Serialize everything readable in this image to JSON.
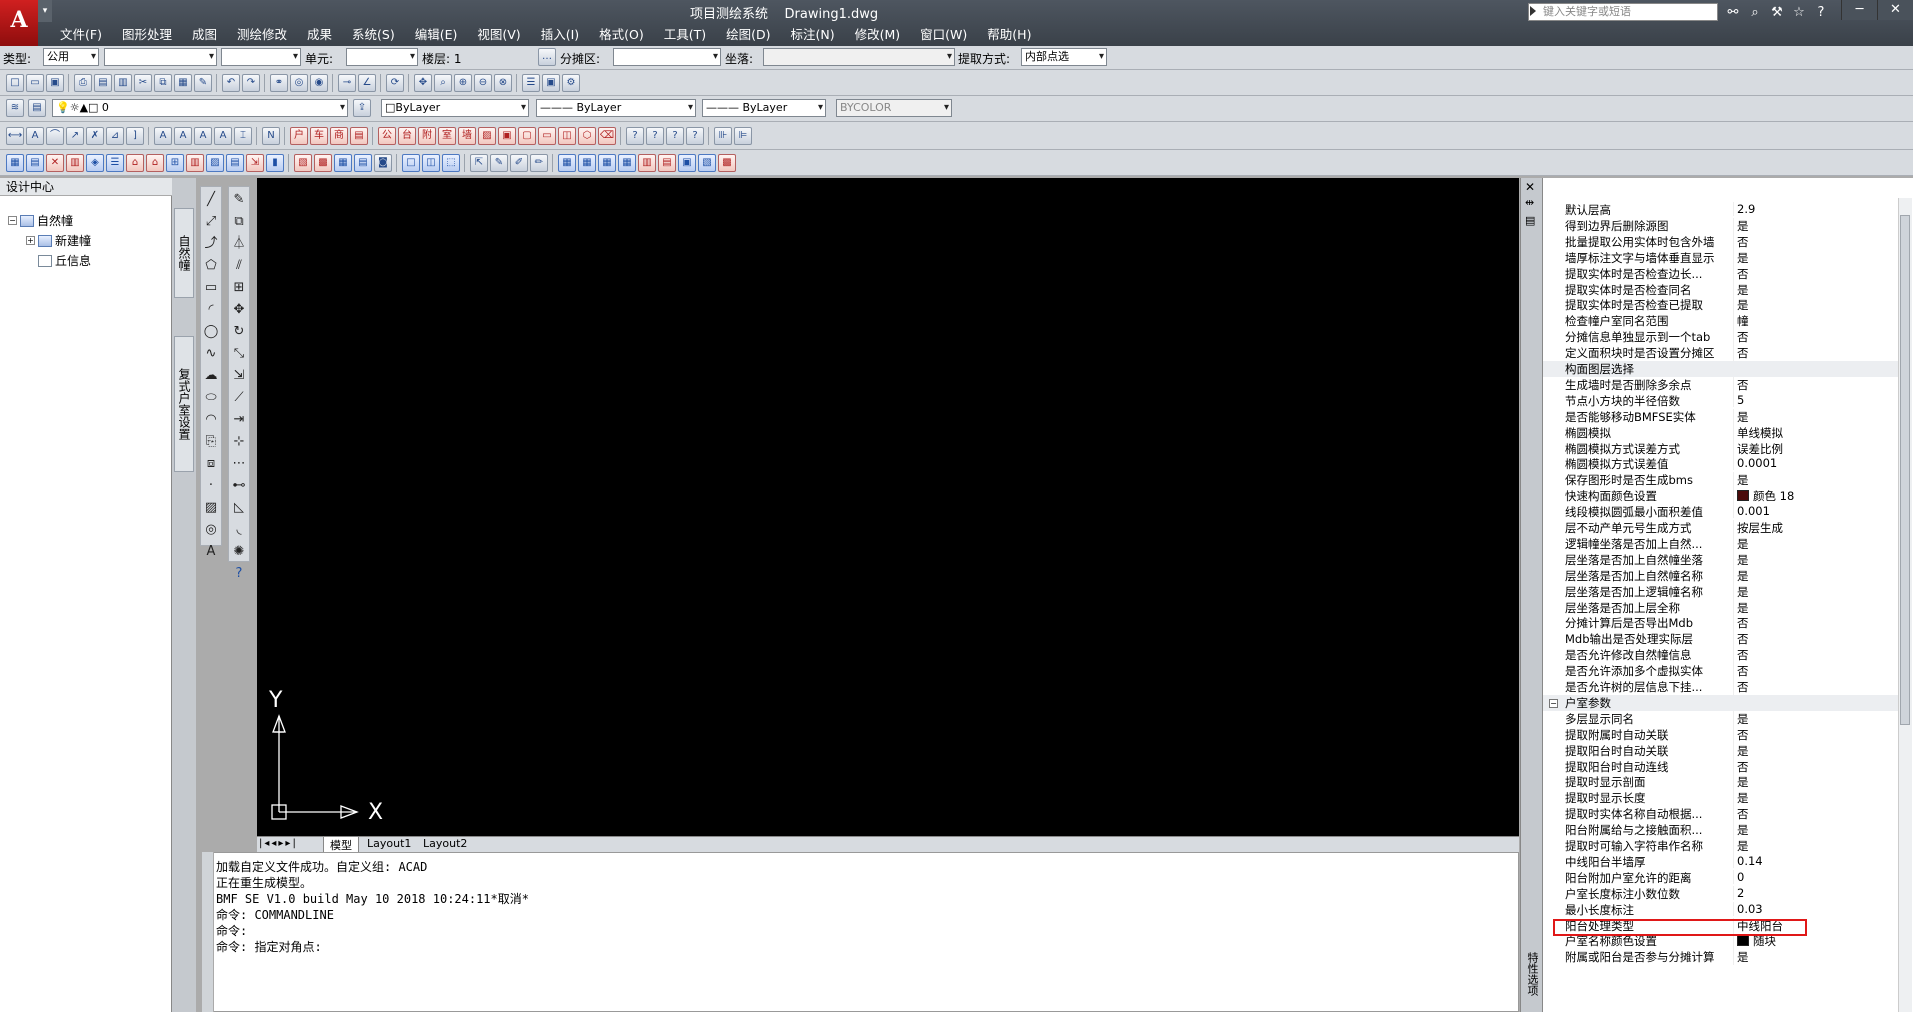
{
  "window": {
    "title": "项目测绘系统",
    "document": "Drawing1.dwg",
    "app_letter": "A",
    "search_placeholder": "键入关键字或短语"
  },
  "menu": [
    "文件(F)",
    "图形处理",
    "成图",
    "测绘修改",
    "成果",
    "系统(S)",
    "编辑(E)",
    "视图(V)",
    "插入(I)",
    "格式(O)",
    "工具(T)",
    "绘图(D)",
    "标注(N)",
    "修改(M)",
    "窗口(W)",
    "帮助(H)"
  ],
  "filter_bar": {
    "type_label": "类型:",
    "type_value": "公用",
    "unit_label": "单元:",
    "floor_label": "楼层:",
    "floor_value": "1",
    "zone_label": "分摊区:",
    "coord_label": "坐落:",
    "extract_label": "提取方式:",
    "extract_value": "内部点选"
  },
  "layer_bar": {
    "layer_name": "0",
    "color": "ByLayer",
    "linetype": "ByLayer",
    "lineweight": "ByLayer",
    "plotstyle": "BYCOLOR"
  },
  "design_center": {
    "title": "设计中心",
    "tree": [
      {
        "label": "自然幢",
        "level": 0,
        "expander": "−"
      },
      {
        "label": "新建幢",
        "level": 1,
        "expander": "+"
      },
      {
        "label": "丘信息",
        "level": 1,
        "expander": ""
      }
    ],
    "side_tabs": [
      "自然幢",
      "复式户室设置"
    ]
  },
  "layout_tabs": [
    "模型",
    "Layout1",
    "Layout2"
  ],
  "ucs": {
    "x": "X",
    "y": "Y"
  },
  "command_lines": [
    "加载自定义文件成功。自定义组: ACAD",
    "正在重生成模型。",
    "BMF SE V1.0 build May 10 2018 10:24:11*取消*",
    "命令: COMMANDLINE",
    "命令:",
    "命令: 指定对角点:"
  ],
  "properties": {
    "strip_label": "特性选项",
    "rows": [
      {
        "key": "默认层高",
        "value": "2.9"
      },
      {
        "key": "得到边界后删除源图",
        "value": "是"
      },
      {
        "key": "批量提取公用实体时包含外墙",
        "value": "否"
      },
      {
        "key": "墙厚标注文字与墙体垂直显示",
        "value": "是"
      },
      {
        "key": "提取实体时是否检查边长...",
        "value": "否"
      },
      {
        "key": "提取实体时是否检查同名",
        "value": "是"
      },
      {
        "key": "提取实体时是否检查已提取",
        "value": "是"
      },
      {
        "key": "检查幢户室同名范围",
        "value": "幢"
      },
      {
        "key": "分摊信息单独显示到一个tab",
        "value": "否"
      },
      {
        "key": "定义面积块时是否设置分摊区",
        "value": "否"
      },
      {
        "key": "构面图层选择",
        "value": "",
        "shade": true
      },
      {
        "key": "生成墙时是否删除多余点",
        "value": "否"
      },
      {
        "key": "节点小方块的半径倍数",
        "value": "5"
      },
      {
        "key": "是否能够移动BMFSE实体",
        "value": "是"
      },
      {
        "key": "椭圆模拟",
        "value": "单线模拟"
      },
      {
        "key": "椭圆模拟方式误差方式",
        "value": "误差比例"
      },
      {
        "key": "椭圆模拟方式误差值",
        "value": "0.0001"
      },
      {
        "key": "保存图形时是否生成bms",
        "value": "是"
      },
      {
        "key": "快速构面颜色设置",
        "value": "颜色 18",
        "swatch": "#4a0a0a"
      },
      {
        "key": "线段模拟圆弧最小面积差值",
        "value": "0.001"
      },
      {
        "key": "层不动产单元号生成方式",
        "value": "按层生成"
      },
      {
        "key": "逻辑幢坐落是否加上自然...",
        "value": "是"
      },
      {
        "key": "层坐落是否加上自然幢坐落",
        "value": "是"
      },
      {
        "key": "层坐落是否加上自然幢名称",
        "value": "是"
      },
      {
        "key": "层坐落是否加上逻辑幢名称",
        "value": "是"
      },
      {
        "key": "层坐落是否加上层全称",
        "value": "是"
      },
      {
        "key": "分摊计算后是否导出Mdb",
        "value": "否"
      },
      {
        "key": "Mdb输出是否处理实际层",
        "value": "否"
      },
      {
        "key": "是否允许修改自然幢信息",
        "value": "否"
      },
      {
        "key": "是否允许添加多个虚拟实体",
        "value": "否"
      },
      {
        "key": "是否允许树的层信息下挂...",
        "value": "否"
      }
    ],
    "category2": "户室参数",
    "rows2": [
      {
        "key": "多层显示同名",
        "value": "是"
      },
      {
        "key": "提取附属时自动关联",
        "value": "否"
      },
      {
        "key": "提取阳台时自动关联",
        "value": "是"
      },
      {
        "key": "提取阳台时自动连线",
        "value": "否"
      },
      {
        "key": "提取时显示剖面",
        "value": "是"
      },
      {
        "key": "提取时显示长度",
        "value": "是"
      },
      {
        "key": "提取时实体名称自动根据...",
        "value": "否"
      },
      {
        "key": "阳台附属给与之接触面积...",
        "value": "是"
      },
      {
        "key": "提取时可输入字符串作名称",
        "value": "是"
      },
      {
        "key": "中线阳台半墙厚",
        "value": "0.14"
      },
      {
        "key": "阳台附加户室允许的距离",
        "value": "0"
      },
      {
        "key": "户室长度标注小数位数",
        "value": "2"
      },
      {
        "key": "最小长度标注",
        "value": "0.03"
      },
      {
        "key": "阳台处理类型",
        "value": "中线阳台"
      },
      {
        "key": "户室名称颜色设置",
        "value": "随块",
        "swatch": "#000000"
      },
      {
        "key": "附属或阳台是否参与分摊计算",
        "value": "是"
      }
    ]
  }
}
